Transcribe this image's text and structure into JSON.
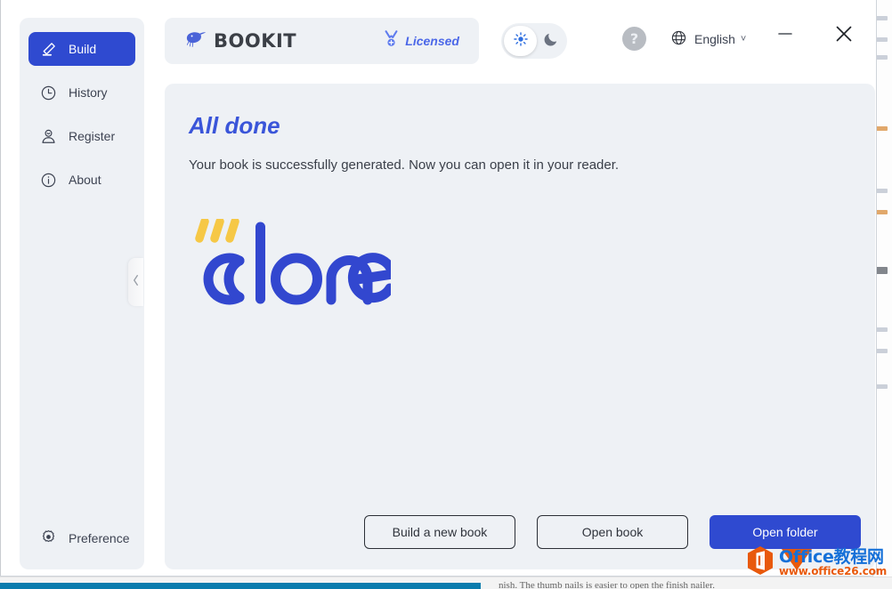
{
  "app": {
    "brand_name": "BOOKIT",
    "brand_icon": "kiwi-bird-icon",
    "license_label": "Licensed",
    "license_icon": "medal-icon",
    "accent_color": "#2f4ad0",
    "title_color": "#3a55d9",
    "panel_color": "#eef1f5"
  },
  "sidebar": {
    "items": [
      {
        "label": "Build",
        "icon": "pencil-icon",
        "active": true
      },
      {
        "label": "History",
        "icon": "clock-icon",
        "active": false
      },
      {
        "label": "Register",
        "icon": "person-icon",
        "active": false
      },
      {
        "label": "About",
        "icon": "info-icon",
        "active": false
      }
    ],
    "preference": {
      "label": "Preference",
      "icon": "gear-icon"
    },
    "collapse_icon": "chevron-left-icon"
  },
  "topbar": {
    "theme_toggle": {
      "light_icon": "sun-icon",
      "dark_icon": "moon-icon",
      "selected": "light"
    },
    "help_label": "?",
    "language": {
      "label": "English",
      "icon": "globe-icon",
      "chevron": "˅"
    },
    "window_controls": {
      "minimize_icon": "minimize-icon",
      "close_icon": "close-icon"
    }
  },
  "main": {
    "title": "All done",
    "subtitle": "Your book is successfully generated. Now you can open it in your reader.",
    "done_graphic_text": "done",
    "done_graphic_accent": "#f6c846",
    "buttons": [
      {
        "label": "Build a new book",
        "style": "secondary",
        "name": "build-a-new-book-button"
      },
      {
        "label": "Open book",
        "style": "secondary",
        "name": "open-book-button"
      },
      {
        "label": "Open folder",
        "style": "primary",
        "name": "open-folder-button"
      }
    ]
  },
  "watermark": {
    "line1": "Office教程网",
    "line2": "www.office26.com"
  },
  "background_window": {
    "bottom_text": "nish. The thumb nails is easier to open the finish nailer."
  }
}
